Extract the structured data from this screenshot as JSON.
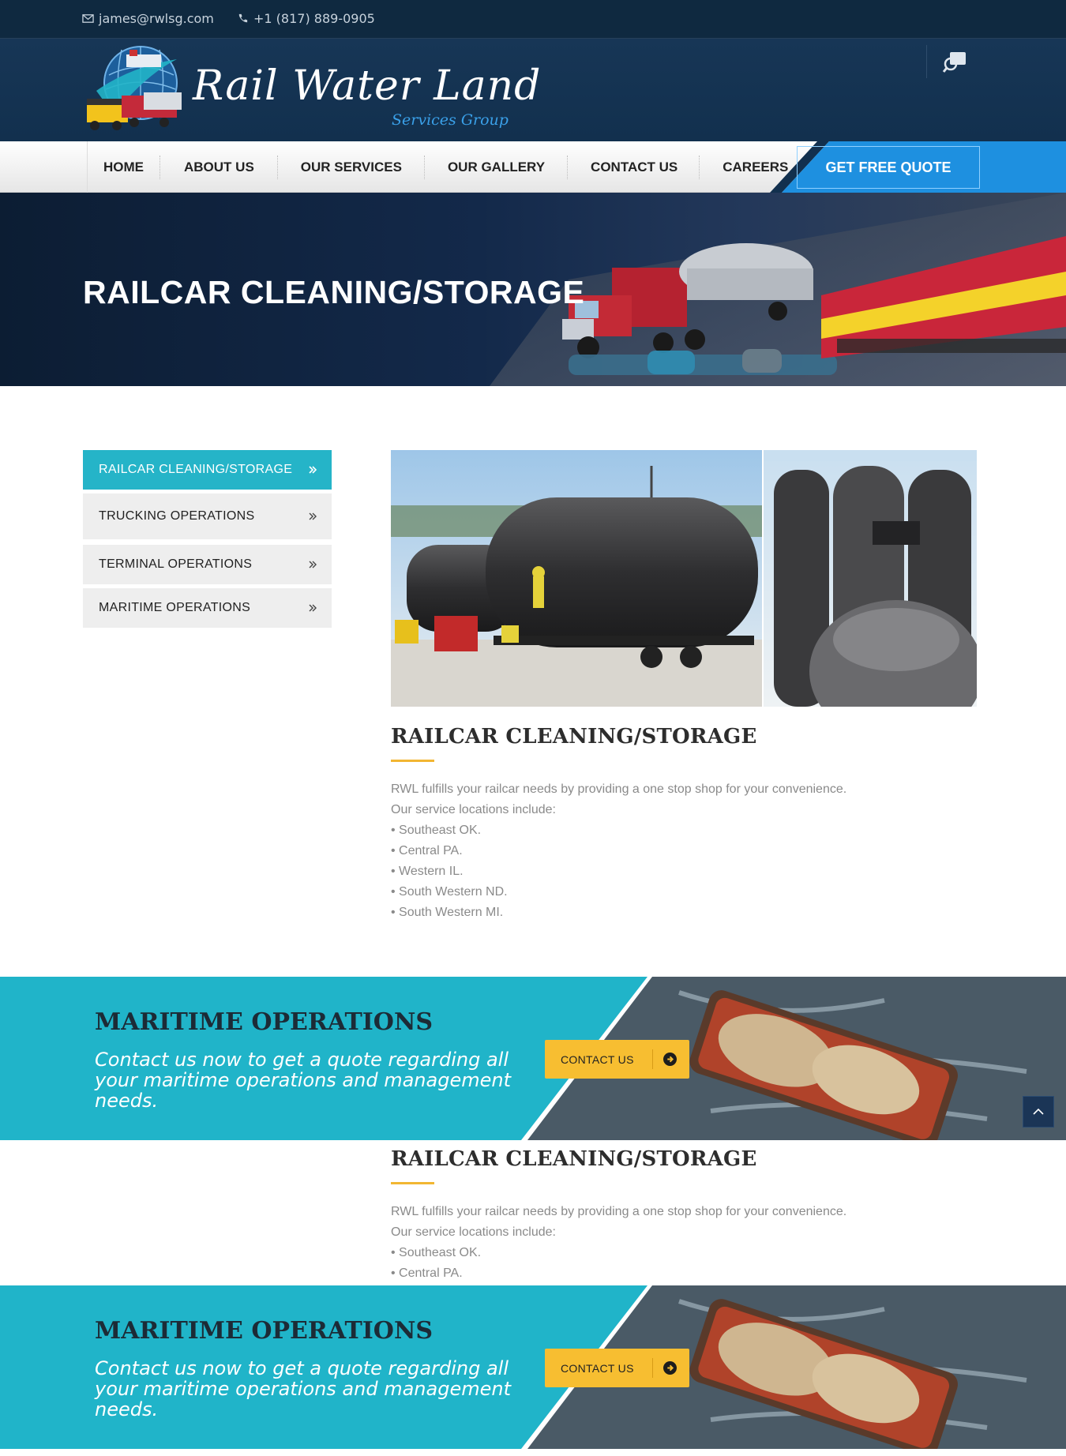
{
  "topbar": {
    "email": "james@rwlsg.com",
    "phone": "+1 (817) 889-0905"
  },
  "brand": {
    "name": "Rail Water Land",
    "tagline": "Services Group"
  },
  "nav": {
    "items": [
      "HOME",
      "ABOUT US",
      "OUR SERVICES",
      "OUR GALLERY",
      "CONTACT US",
      "CAREERS"
    ],
    "quote_label": "GET FREE QUOTE"
  },
  "hero": {
    "title": "RAILCAR CLEANING/STORAGE"
  },
  "sidebar": {
    "items": [
      {
        "label": "RAILCAR CLEANING/STORAGE",
        "active": true
      },
      {
        "label": "TRUCKING OPERATIONS",
        "active": false
      },
      {
        "label": "TERMINAL OPERATIONS",
        "active": false
      },
      {
        "label": "MARITIME OPERATIONS",
        "active": false
      }
    ]
  },
  "main": {
    "heading": "RAILCAR CLEANING/STORAGE",
    "intro": "RWL fulfills your railcar needs by providing a one stop shop for your convenience.",
    "locations_label": "Our service locations include:",
    "locations": [
      "• Southeast OK.",
      "• Central PA.",
      "• Western IL.",
      "• South Western ND.",
      "• South Western MI."
    ]
  },
  "cta": {
    "title": "MARITIME OPERATIONS",
    "text": "Contact us now to get a quote regarding all your maritime operations and management needs.",
    "button": "CONTACT US"
  },
  "colors": {
    "topbar": "#0f2940",
    "header": "#173656",
    "accent_teal": "#25b4c8",
    "accent_blue": "#1e90e0",
    "button_yellow": "#f7be31",
    "rule_yellow": "#f2b632"
  },
  "icons": {
    "email": "envelope-icon",
    "phone": "phone-icon",
    "search": "search-icon",
    "chevron": "double-chevron-right-icon",
    "arrow": "circle-arrow-right-icon",
    "to_top": "chevron-up-icon"
  }
}
